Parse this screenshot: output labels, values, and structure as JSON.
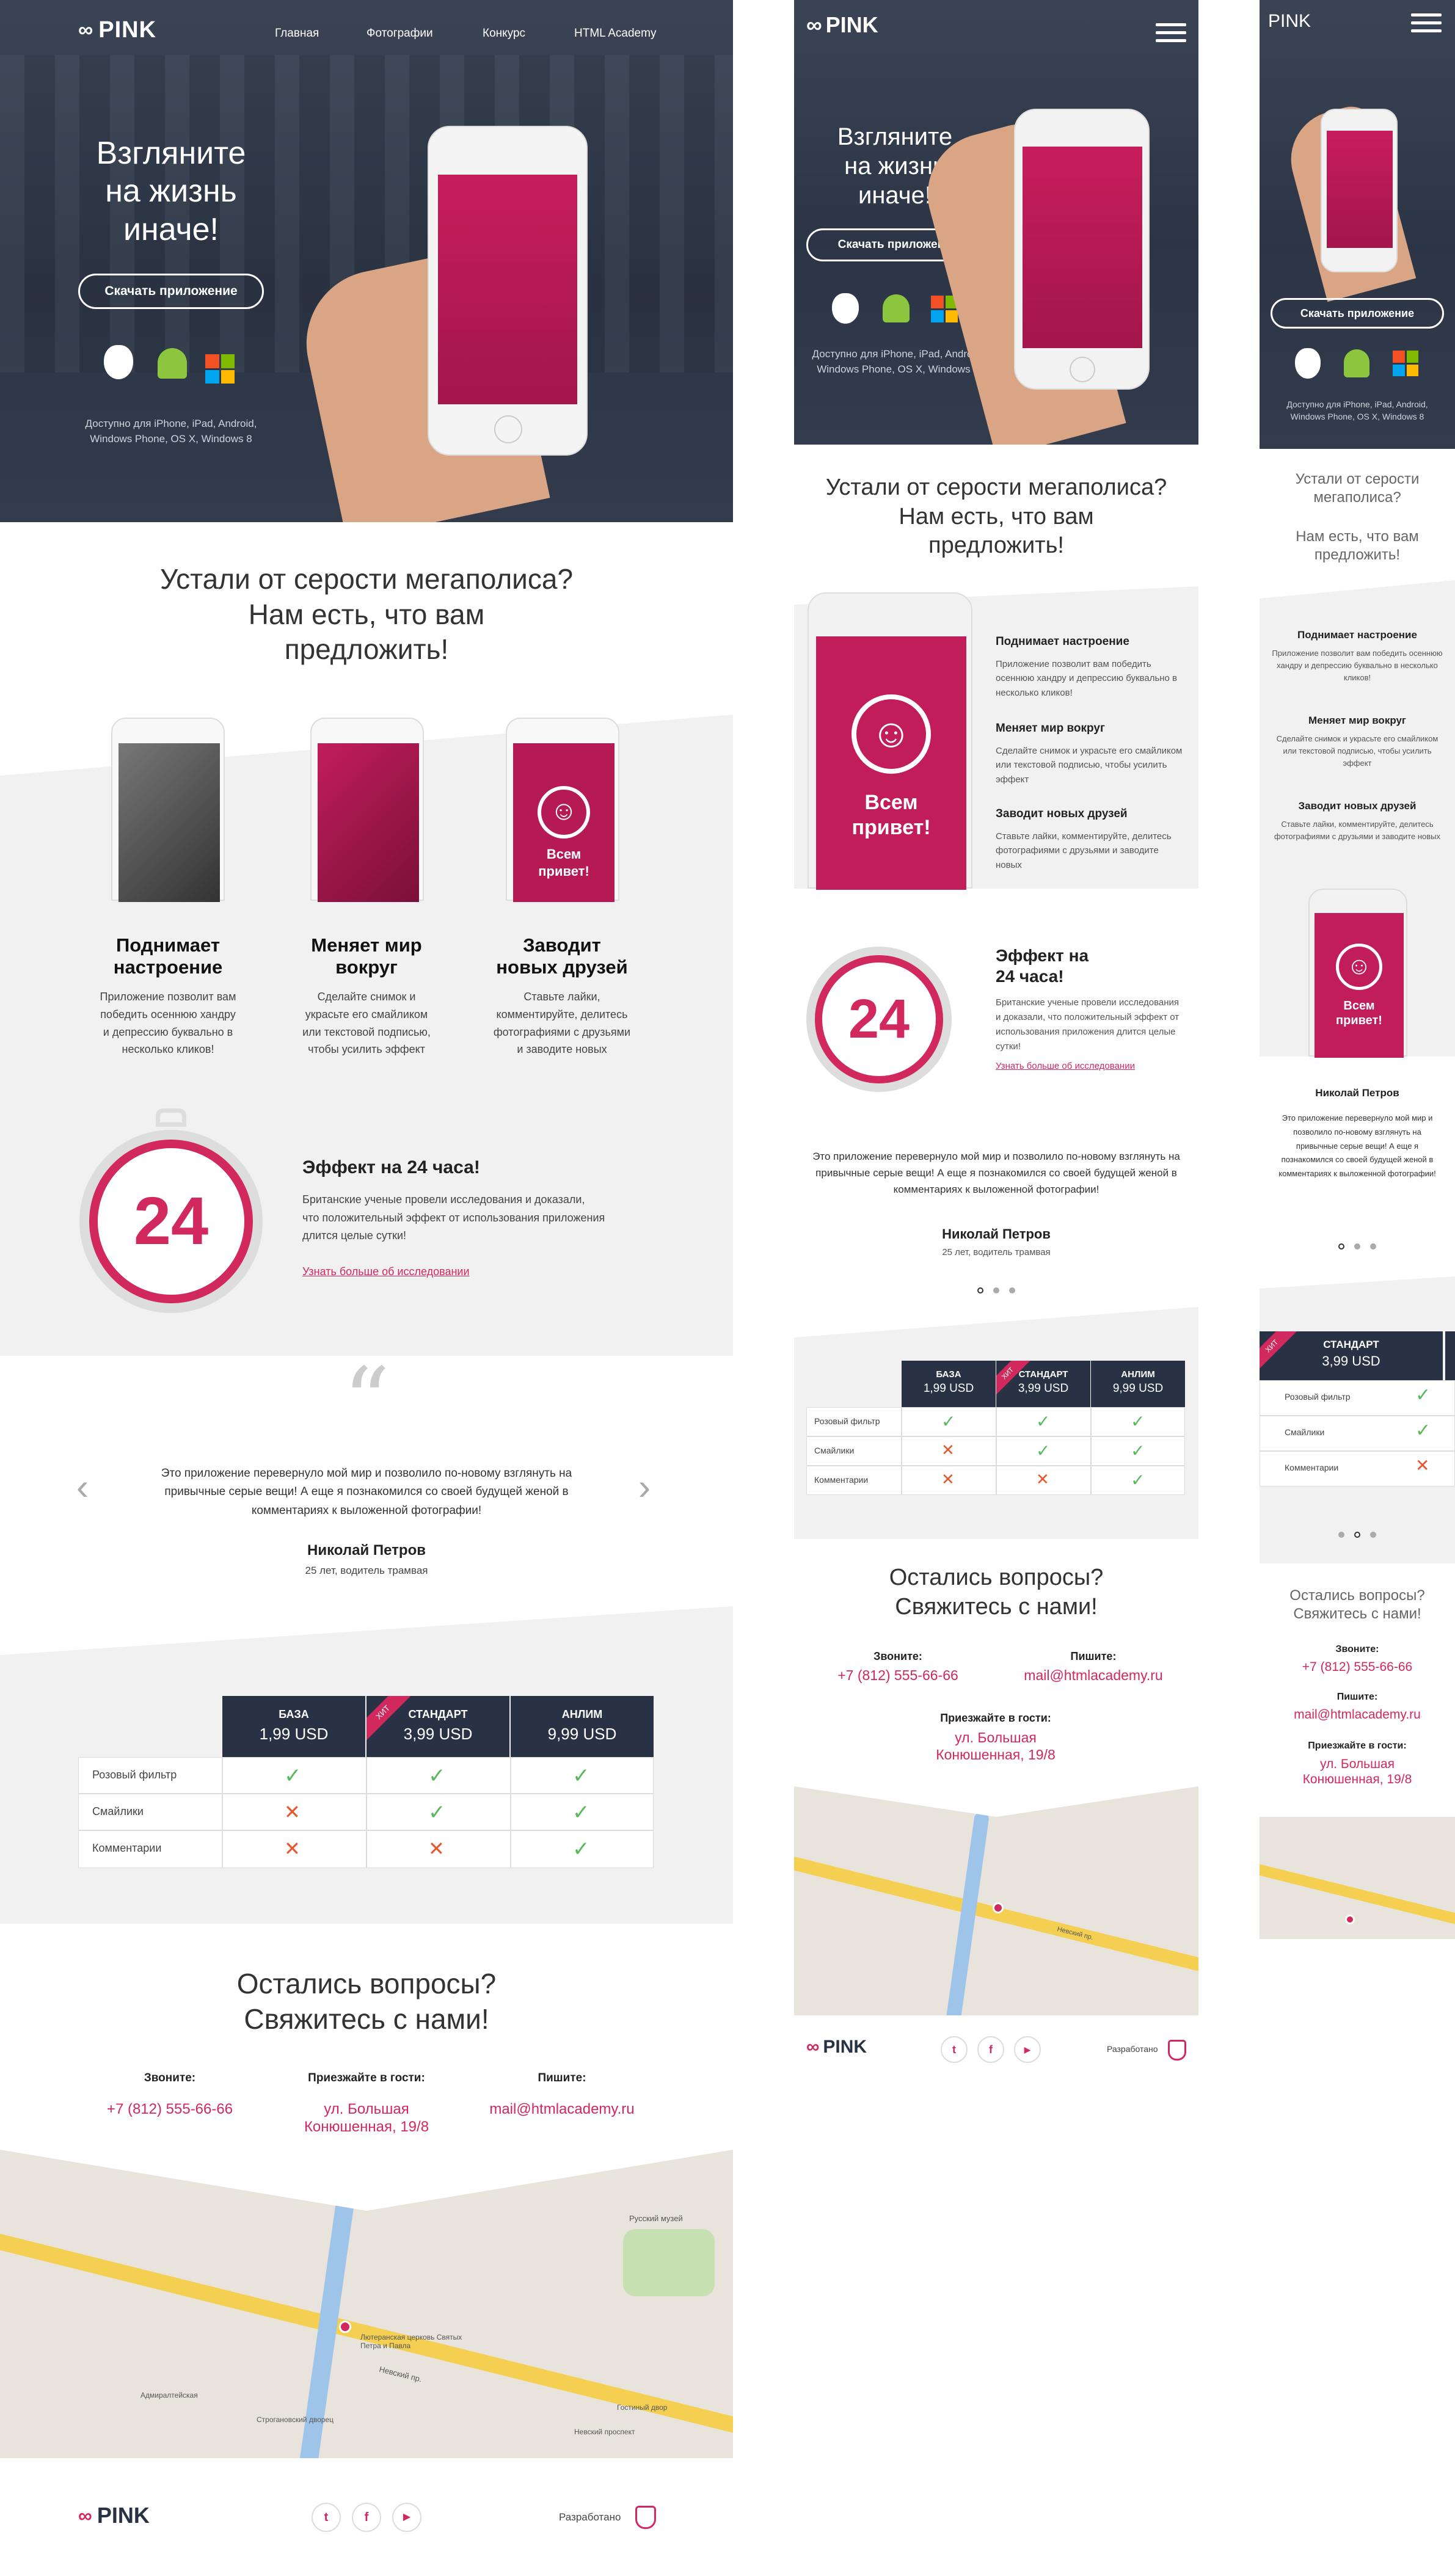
{
  "brand": {
    "name": "PINK"
  },
  "nav": {
    "items": [
      "Главная",
      "Фотографии",
      "Конкурс",
      "HTML Academy"
    ]
  },
  "hero": {
    "title_lines": [
      "Взгляните",
      "на жизнь",
      "иначе!"
    ],
    "cta": "Скачать приложение",
    "platforms_note_l1": "Доступно для iPhone, iPad, Android,",
    "platforms_note_l2": "Windows Phone, OS X, Windows 8",
    "platform_icons": [
      "apple-icon",
      "android-icon",
      "windows-icon"
    ]
  },
  "intro": {
    "title_l1": "Устали от серости мегаполиса?",
    "title_l2": "Нам есть, что вам",
    "title_l3": "предложить!"
  },
  "features": [
    {
      "title_l1": "Поднимает",
      "title_l2": "настроение",
      "text_l1": "Приложение позволит вам",
      "text_l2": "победить осеннюю хандру",
      "text_l3": "и депрессию буквально в",
      "text_l4": "несколько кликов!"
    },
    {
      "title_l1": "Меняет мир",
      "title_l2": "вокруг",
      "text_l1": "Сделайте снимок и",
      "text_l2": "украсьте его смайликом",
      "text_l3": "или текстовой подписью,",
      "text_l4": "чтобы усилить эффект"
    },
    {
      "title_l1": "Заводит",
      "title_l2": "новых друзей",
      "text_l1": "Ставьте лайки,",
      "text_l2": "комментируйте, делитесь",
      "text_l3": "фотографиями с друзьями",
      "text_l4": "и заводите новых"
    }
  ],
  "phone_screen": {
    "greeting_l1": "Всем",
    "greeting_l2": "привет!"
  },
  "effect": {
    "number": "24",
    "title": "Эффект на 24 часа!",
    "text_l1": "Британские ученые провели исследования и доказали,",
    "text_l2": "что положительный эффект от использования приложения",
    "text_l3": "длится целые сутки!",
    "link": "Узнать больше об исследовании"
  },
  "review": {
    "quote_mark": "“",
    "text_l1": "Это приложение перевернуло мой мир и позволило по-новому взглянуть на",
    "text_l2": "привычные серые вещи! А еще я познакомился со своей будущей женой в",
    "text_l3": "комментариях к выложенной фотографии!",
    "author": "Николай Петров",
    "role": "25 лет, водитель трамвая",
    "prev": "‹",
    "next": "›"
  },
  "pricing": {
    "plans": [
      {
        "name": "БАЗА",
        "price": "1,99 USD"
      },
      {
        "name": "СТАНДАРТ",
        "price": "3,99 USD",
        "badge": "ХИТ"
      },
      {
        "name": "АНЛИМ",
        "price": "9,99 USD"
      }
    ],
    "rows": [
      {
        "label": "Розовый фильтр",
        "values": [
          "check",
          "check",
          "check"
        ]
      },
      {
        "label": "Смайлики",
        "values": [
          "cross",
          "check",
          "check"
        ]
      },
      {
        "label": "Комментарии",
        "values": [
          "cross",
          "cross",
          "check"
        ]
      }
    ],
    "check_glyph": "✓",
    "cross_glyph": "✕"
  },
  "contacts": {
    "title_l1": "Остались вопросы?",
    "title_l2": "Свяжитесь с нами!",
    "call_label": "Звоните:",
    "phone": "+7 (812) 555-66-66",
    "visit_label": "Приезжайте в гости:",
    "address_l1": "ул. Большая",
    "address_l2": "Конюшенная, 19/8",
    "write_label": "Пишите:",
    "email": "mail@htmlacademy.ru"
  },
  "map": {
    "labels": [
      "Невский пр.",
      "Русский музей",
      "Лютеранская церковь Святых Петра и Павла",
      "Адмиралтейская",
      "Строгановский дворец",
      "Невский проспект",
      "Гостиный двор"
    ]
  },
  "footer": {
    "socials": [
      "twitter-icon",
      "facebook-icon",
      "youtube-icon"
    ],
    "social_glyphs": [
      "t",
      "f",
      "▶"
    ],
    "credit": "Разработано"
  }
}
